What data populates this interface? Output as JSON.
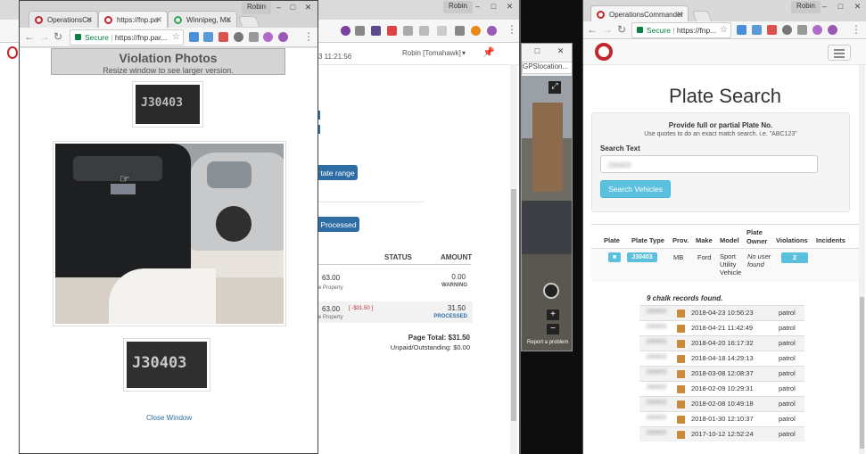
{
  "colors": {
    "brand": "#c1272d",
    "primary": "#2e6da4",
    "info": "#5bc0de",
    "panel": "#f5f5f5"
  },
  "left_window": {
    "profile": "Robin",
    "tabs": [
      {
        "label": "OperationsCo",
        "icon": "opcom-icon"
      },
      {
        "label": "https://fnp.pa",
        "icon": "opcom-icon"
      },
      {
        "label": "Winnipeg, Ma",
        "icon": "maps-icon"
      }
    ],
    "secure": "Secure",
    "url": "https://fnp.par...",
    "panel": {
      "title": "Violation Photos",
      "subtitle": "Resize window to see larger version."
    },
    "plate_text_1": "J30403",
    "plate_text_2": "J30403",
    "close_link": "Close Window"
  },
  "background_window": {
    "profile": "Robin",
    "time": "3 11:21:56",
    "user": "Robin [Tomahawk]",
    "date_range_button": "tate range",
    "processed_button": "Processed",
    "columns": {
      "status": "STATUS",
      "amount": "AMOUNT"
    },
    "rows": [
      {
        "amt": "63.00",
        "desc": "e Property",
        "extra": "",
        "value": "0.00",
        "status": "WARNING"
      },
      {
        "amt": "63.00",
        "desc": "e Property",
        "extra": "[ -$31.50 ]",
        "value": "31.50",
        "status": "PROCESSED"
      }
    ],
    "page_total": "Page Total: $31.50",
    "unpaid": "Unpaid/Outstanding: $0.00"
  },
  "map_window": {
    "url": "GPSlocation...",
    "report": "Report a problem"
  },
  "right_window": {
    "profile": "Robin",
    "tab": "OperationsCommander",
    "secure": "Secure",
    "url": "https://fnp...",
    "title": "Plate Search",
    "help_title": "Provide full or partial Plate No.",
    "help_text": "Use quotes to do an exact match search. i.e. \"ABC123\"",
    "search_label": "Search Text",
    "search_value": "J30403",
    "search_button": "Search Vehicles",
    "table": {
      "headers": [
        "Plate",
        "Plate Type",
        "Prov.",
        "Make",
        "Model",
        "Plate Owner",
        "Violations",
        "Incidents"
      ],
      "row": {
        "type": "J30403",
        "prov": "MB",
        "make": "Ford",
        "model": "Sport Utility Vehicle",
        "owner": "No user found",
        "violations": "2"
      }
    },
    "chalk_count": "9 chalk records found.",
    "chalk": [
      {
        "plate": "J30403",
        "date": "2018-04-23 10:56:23",
        "src": "patrol"
      },
      {
        "plate": "J30403",
        "date": "2018-04-21 11:42:49",
        "src": "patrol"
      },
      {
        "plate": "J30403",
        "date": "2018-04-20 16:17:32",
        "src": "patrol"
      },
      {
        "plate": "J30403",
        "date": "2018-04-18 14:29:13",
        "src": "patrol"
      },
      {
        "plate": "J30403",
        "date": "2018-03-08 12:08:37",
        "src": "patrol"
      },
      {
        "plate": "J30403",
        "date": "2018-02-09 10:29:31",
        "src": "patrol"
      },
      {
        "plate": "J30403",
        "date": "2018-02-08 10:49:18",
        "src": "patrol"
      },
      {
        "plate": "J30403",
        "date": "2018-01-30 12:10:37",
        "src": "patrol"
      },
      {
        "plate": "J30403",
        "date": "2017-10-12 12:52:24",
        "src": "patrol"
      }
    ]
  }
}
